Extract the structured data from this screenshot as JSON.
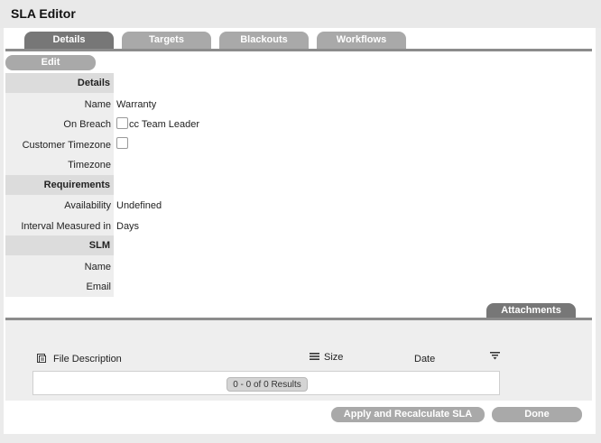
{
  "window": {
    "title": "SLA Editor"
  },
  "tabs": [
    {
      "label": "Details",
      "active": true
    },
    {
      "label": "Targets",
      "active": false
    },
    {
      "label": "Blackouts",
      "active": false
    },
    {
      "label": "Workflows",
      "active": false
    }
  ],
  "toolbar": {
    "edit_label": "Edit"
  },
  "sections": {
    "details": {
      "heading": "Details",
      "name_label": "Name",
      "name_value": "Warranty",
      "on_breach_label": "On Breach",
      "on_breach_option": "cc Team Leader",
      "on_breach_checked": false,
      "customer_timezone_label": "Customer Timezone",
      "customer_timezone_checked": false,
      "timezone_label": "Timezone",
      "timezone_value": ""
    },
    "requirements": {
      "heading": "Requirements",
      "availability_label": "Availability",
      "availability_value": "Undefined",
      "interval_label": "Interval Measured in",
      "interval_value": "Days"
    },
    "slm": {
      "heading": "SLM",
      "name_label": "Name",
      "name_value": "",
      "email_label": "Email",
      "email_value": ""
    }
  },
  "attachments": {
    "tab_label": "Attachments",
    "columns": {
      "file_description": "File Description",
      "size": "Size",
      "date": "Date"
    },
    "pager_text": "0 - 0 of 0 Results"
  },
  "footer": {
    "apply_label": "Apply and Recalculate SLA",
    "done_label": "Done"
  },
  "colors": {
    "tab_active": "#777777",
    "tab_inactive": "#a9a9a9",
    "button": "#a9a9a9",
    "section_header": "#dcdcdc",
    "label_column": "#eeeeee"
  },
  "icons": {
    "file_description": "document-icon",
    "size": "menu-lines-icon",
    "date_filter": "filter-icon"
  }
}
